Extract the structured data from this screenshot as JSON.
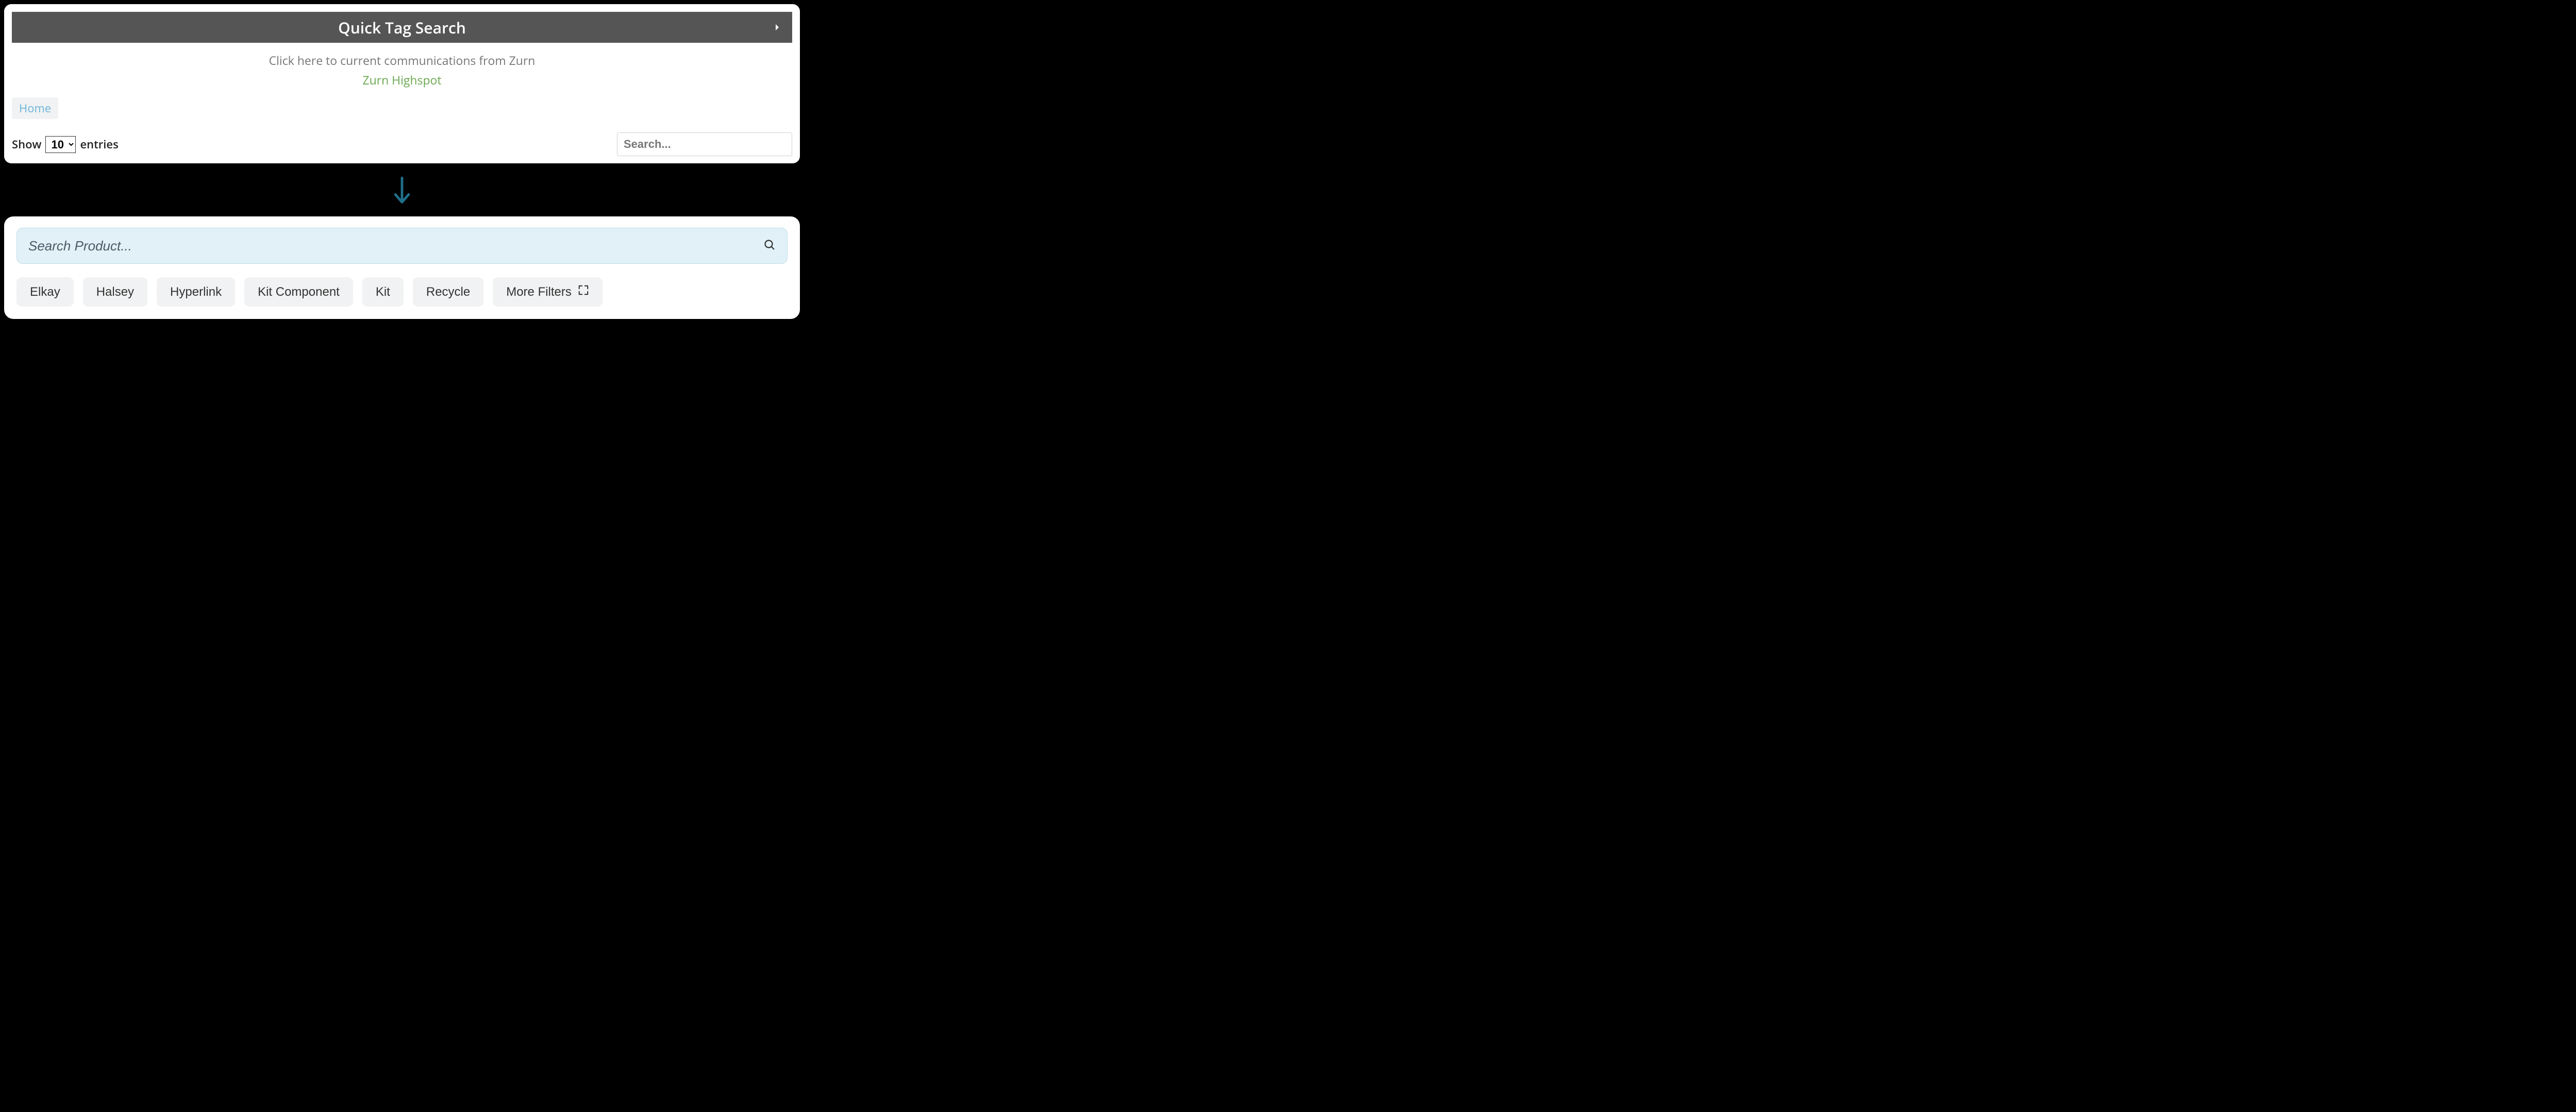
{
  "old_panel": {
    "title": "Quick Tag Search",
    "subtext": "Click here to current communications from Zurn",
    "link_text": "Zurn Highspot",
    "breadcrumb": "Home",
    "show_label_prefix": "Show",
    "show_label_suffix": "entries",
    "show_value": "10",
    "search_placeholder": "Search..."
  },
  "new_panel": {
    "search_placeholder": "Search Product...",
    "filters": [
      "Elkay",
      "Halsey",
      "Hyperlink",
      "Kit Component",
      "Kit",
      "Recycle"
    ],
    "more_filters_label": "More Filters"
  }
}
